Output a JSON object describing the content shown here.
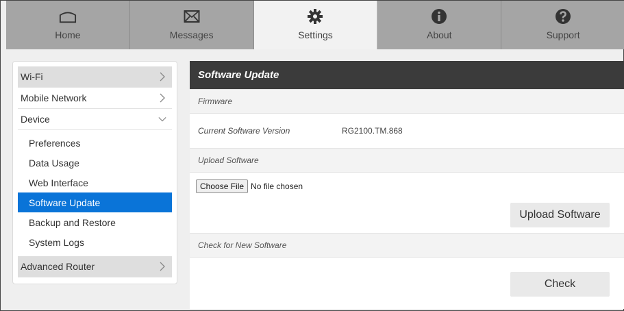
{
  "nav": {
    "tabs": [
      {
        "label": "Home",
        "icon": "home-icon"
      },
      {
        "label": "Messages",
        "icon": "envelope-icon"
      },
      {
        "label": "Settings",
        "icon": "gear-icon"
      },
      {
        "label": "About",
        "icon": "info-icon"
      },
      {
        "label": "Support",
        "icon": "question-icon"
      }
    ],
    "active": "Settings"
  },
  "sidebar": {
    "items": [
      {
        "label": "Wi-Fi"
      },
      {
        "label": "Mobile Network"
      },
      {
        "label": "Device"
      },
      {
        "label": "Advanced Router"
      }
    ],
    "device_sub": [
      {
        "label": "Preferences"
      },
      {
        "label": "Data Usage"
      },
      {
        "label": "Web Interface"
      },
      {
        "label": "Software Update"
      },
      {
        "label": "Backup and Restore"
      },
      {
        "label": "System Logs"
      }
    ]
  },
  "main": {
    "title": "Software Update",
    "firmware_heading": "Firmware",
    "current_version_label": "Current Software Version",
    "current_version_value": "RG2100.TM.868",
    "upload_heading": "Upload Software",
    "choose_file_label": "Choose File",
    "file_status": "No file chosen",
    "upload_button": "Upload Software",
    "check_heading": "Check for New Software",
    "check_button": "Check"
  },
  "colors": {
    "accent": "#0a74d8",
    "header_bg": "#3b3b3b",
    "tab_bg": "#a5a5a5"
  }
}
